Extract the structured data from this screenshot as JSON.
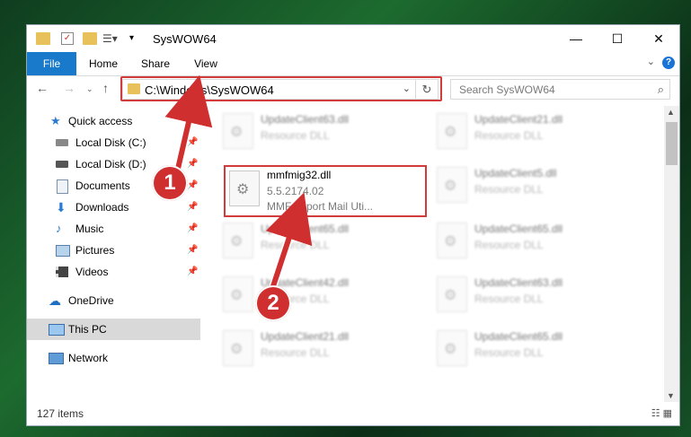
{
  "window": {
    "title": "SysWOW64"
  },
  "titlebar": {
    "minimize": "—",
    "maximize": "☐",
    "close": "✕"
  },
  "ribbon": {
    "tabs": [
      "File",
      "Home",
      "Share",
      "View"
    ],
    "help": "?"
  },
  "navbar": {
    "address": "C:\\Windows\\SysWOW64",
    "search_placeholder": "Search SysWOW64"
  },
  "sidebar": {
    "items": [
      {
        "label": "Quick access",
        "icon": "star-icon"
      },
      {
        "label": "Local Disk (C:)",
        "icon": "drive-icon",
        "pinned": true
      },
      {
        "label": "Local Disk (D:)",
        "icon": "drive-icon",
        "pinned": true
      },
      {
        "label": "Documents",
        "icon": "documents-icon",
        "pinned": true
      },
      {
        "label": "Downloads",
        "icon": "download-icon",
        "pinned": true
      },
      {
        "label": "Music",
        "icon": "music-icon",
        "pinned": true
      },
      {
        "label": "Pictures",
        "icon": "pictures-icon",
        "pinned": true
      },
      {
        "label": "Videos",
        "icon": "videos-icon",
        "pinned": true
      },
      {
        "label": "OneDrive",
        "icon": "cloud-icon"
      },
      {
        "label": "This PC",
        "icon": "computer-icon",
        "selected": true
      },
      {
        "label": "Network",
        "icon": "network-icon"
      }
    ]
  },
  "files": [
    {
      "name": "UpdateClient63.dll",
      "type": "Resource DLL"
    },
    {
      "name": "UpdateClient21.dll",
      "type": "Resource DLL"
    },
    {
      "name": "mmfmig32.dll",
      "version": "5.5.2174.02",
      "description": "MMF Import Mail Uti..."
    },
    {
      "name": "UpdateClient5.dll",
      "type": "Resource DLL"
    },
    {
      "name": "UpdateClient65.dll",
      "type": "Resource DLL"
    },
    {
      "name": "UpdateClient65.dll",
      "type": "Resource DLL"
    },
    {
      "name": "UpdateClient42.dll",
      "type": "Resource DLL"
    },
    {
      "name": "UpdateClient63.dll",
      "type": "Resource DLL"
    },
    {
      "name": "UpdateClient21.dll",
      "type": "Resource DLL"
    },
    {
      "name": "UpdateClient65.dll",
      "type": "Resource DLL"
    }
  ],
  "status": {
    "item_count": "127 items"
  },
  "annotations": {
    "step1": "1",
    "step2": "2"
  },
  "colors": {
    "accent": "#1979ca",
    "highlight": "#d23b3b",
    "badge": "#cf2f2f"
  }
}
